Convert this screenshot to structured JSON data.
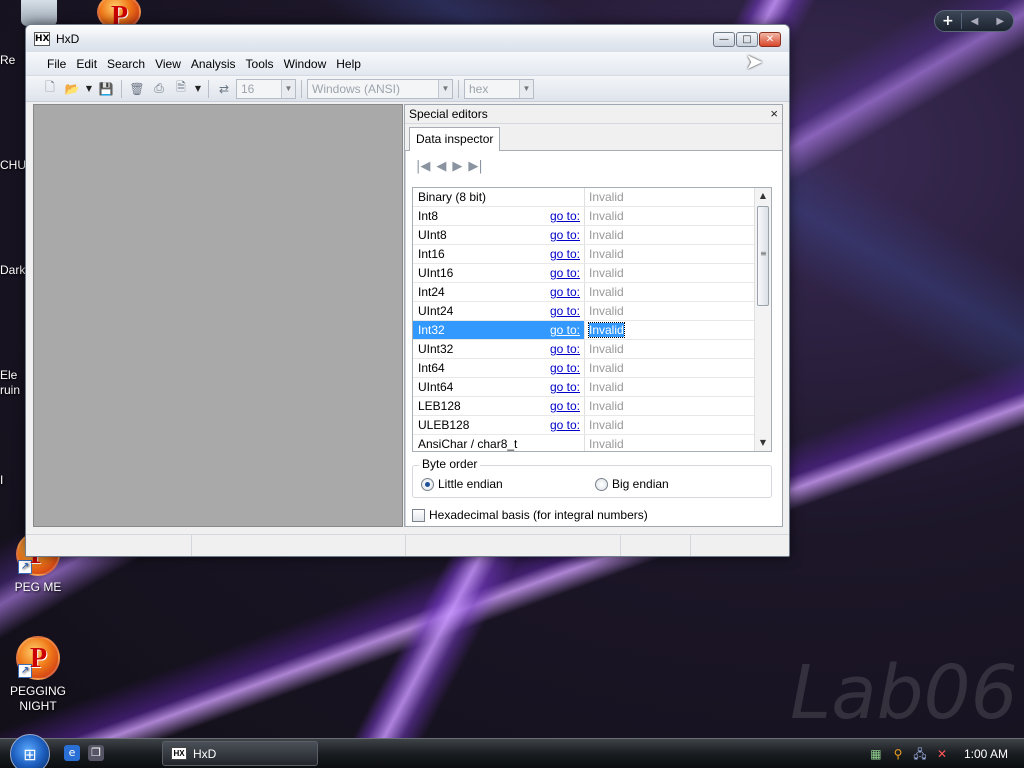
{
  "desktop": {
    "icons": [
      {
        "label": "PEG ME"
      },
      {
        "label": "PEGGING NIGHT"
      }
    ],
    "clipped_labels": [
      "Re",
      "CHU",
      "Dark",
      "Ele",
      "ruin",
      "I"
    ],
    "watermark": "Lab06"
  },
  "window": {
    "title": "HxD",
    "app_icon_text": "HX",
    "controls": {
      "minimize": "—",
      "maximize": "□",
      "close": "✕"
    }
  },
  "menu": [
    "File",
    "Edit",
    "Search",
    "View",
    "Analysis",
    "Tools",
    "Window",
    "Help"
  ],
  "toolbar": {
    "bytes_per_row": "16",
    "charset": "Windows (ANSI)",
    "offset_base": "hex"
  },
  "special_editors": {
    "title": "Special editors",
    "close": "×",
    "tab": "Data inspector",
    "nav": [
      "|◀",
      "◀",
      "▶",
      "▶|"
    ],
    "rows": [
      {
        "name": "Binary (8 bit)",
        "goto": "",
        "value": "Invalid"
      },
      {
        "name": "Int8",
        "goto": "go to:",
        "value": "Invalid"
      },
      {
        "name": "UInt8",
        "goto": "go to:",
        "value": "Invalid"
      },
      {
        "name": "Int16",
        "goto": "go to:",
        "value": "Invalid"
      },
      {
        "name": "UInt16",
        "goto": "go to:",
        "value": "Invalid"
      },
      {
        "name": "Int24",
        "goto": "go to:",
        "value": "Invalid"
      },
      {
        "name": "UInt24",
        "goto": "go to:",
        "value": "Invalid"
      },
      {
        "name": "Int32",
        "goto": "go to:",
        "value": "Invalid"
      },
      {
        "name": "UInt32",
        "goto": "go to:",
        "value": "Invalid"
      },
      {
        "name": "Int64",
        "goto": "go to:",
        "value": "Invalid"
      },
      {
        "name": "UInt64",
        "goto": "go to:",
        "value": "Invalid"
      },
      {
        "name": "LEB128",
        "goto": "go to:",
        "value": "Invalid"
      },
      {
        "name": "ULEB128",
        "goto": "go to:",
        "value": "Invalid"
      },
      {
        "name": "AnsiChar / char8_t",
        "goto": "",
        "value": "Invalid"
      }
    ],
    "selected_row": "Int32",
    "byte_order": {
      "label": "Byte order",
      "little": "Little endian",
      "big": "Big endian",
      "selected": "Little endian"
    },
    "hex_basis": "Hexadecimal basis (for integral numbers)"
  },
  "taskbar": {
    "task": "HxD",
    "clock": "1:00 AM"
  },
  "colors": {
    "selection": "#3399ff",
    "link": "#0000c8",
    "muted_value": "#999999"
  }
}
